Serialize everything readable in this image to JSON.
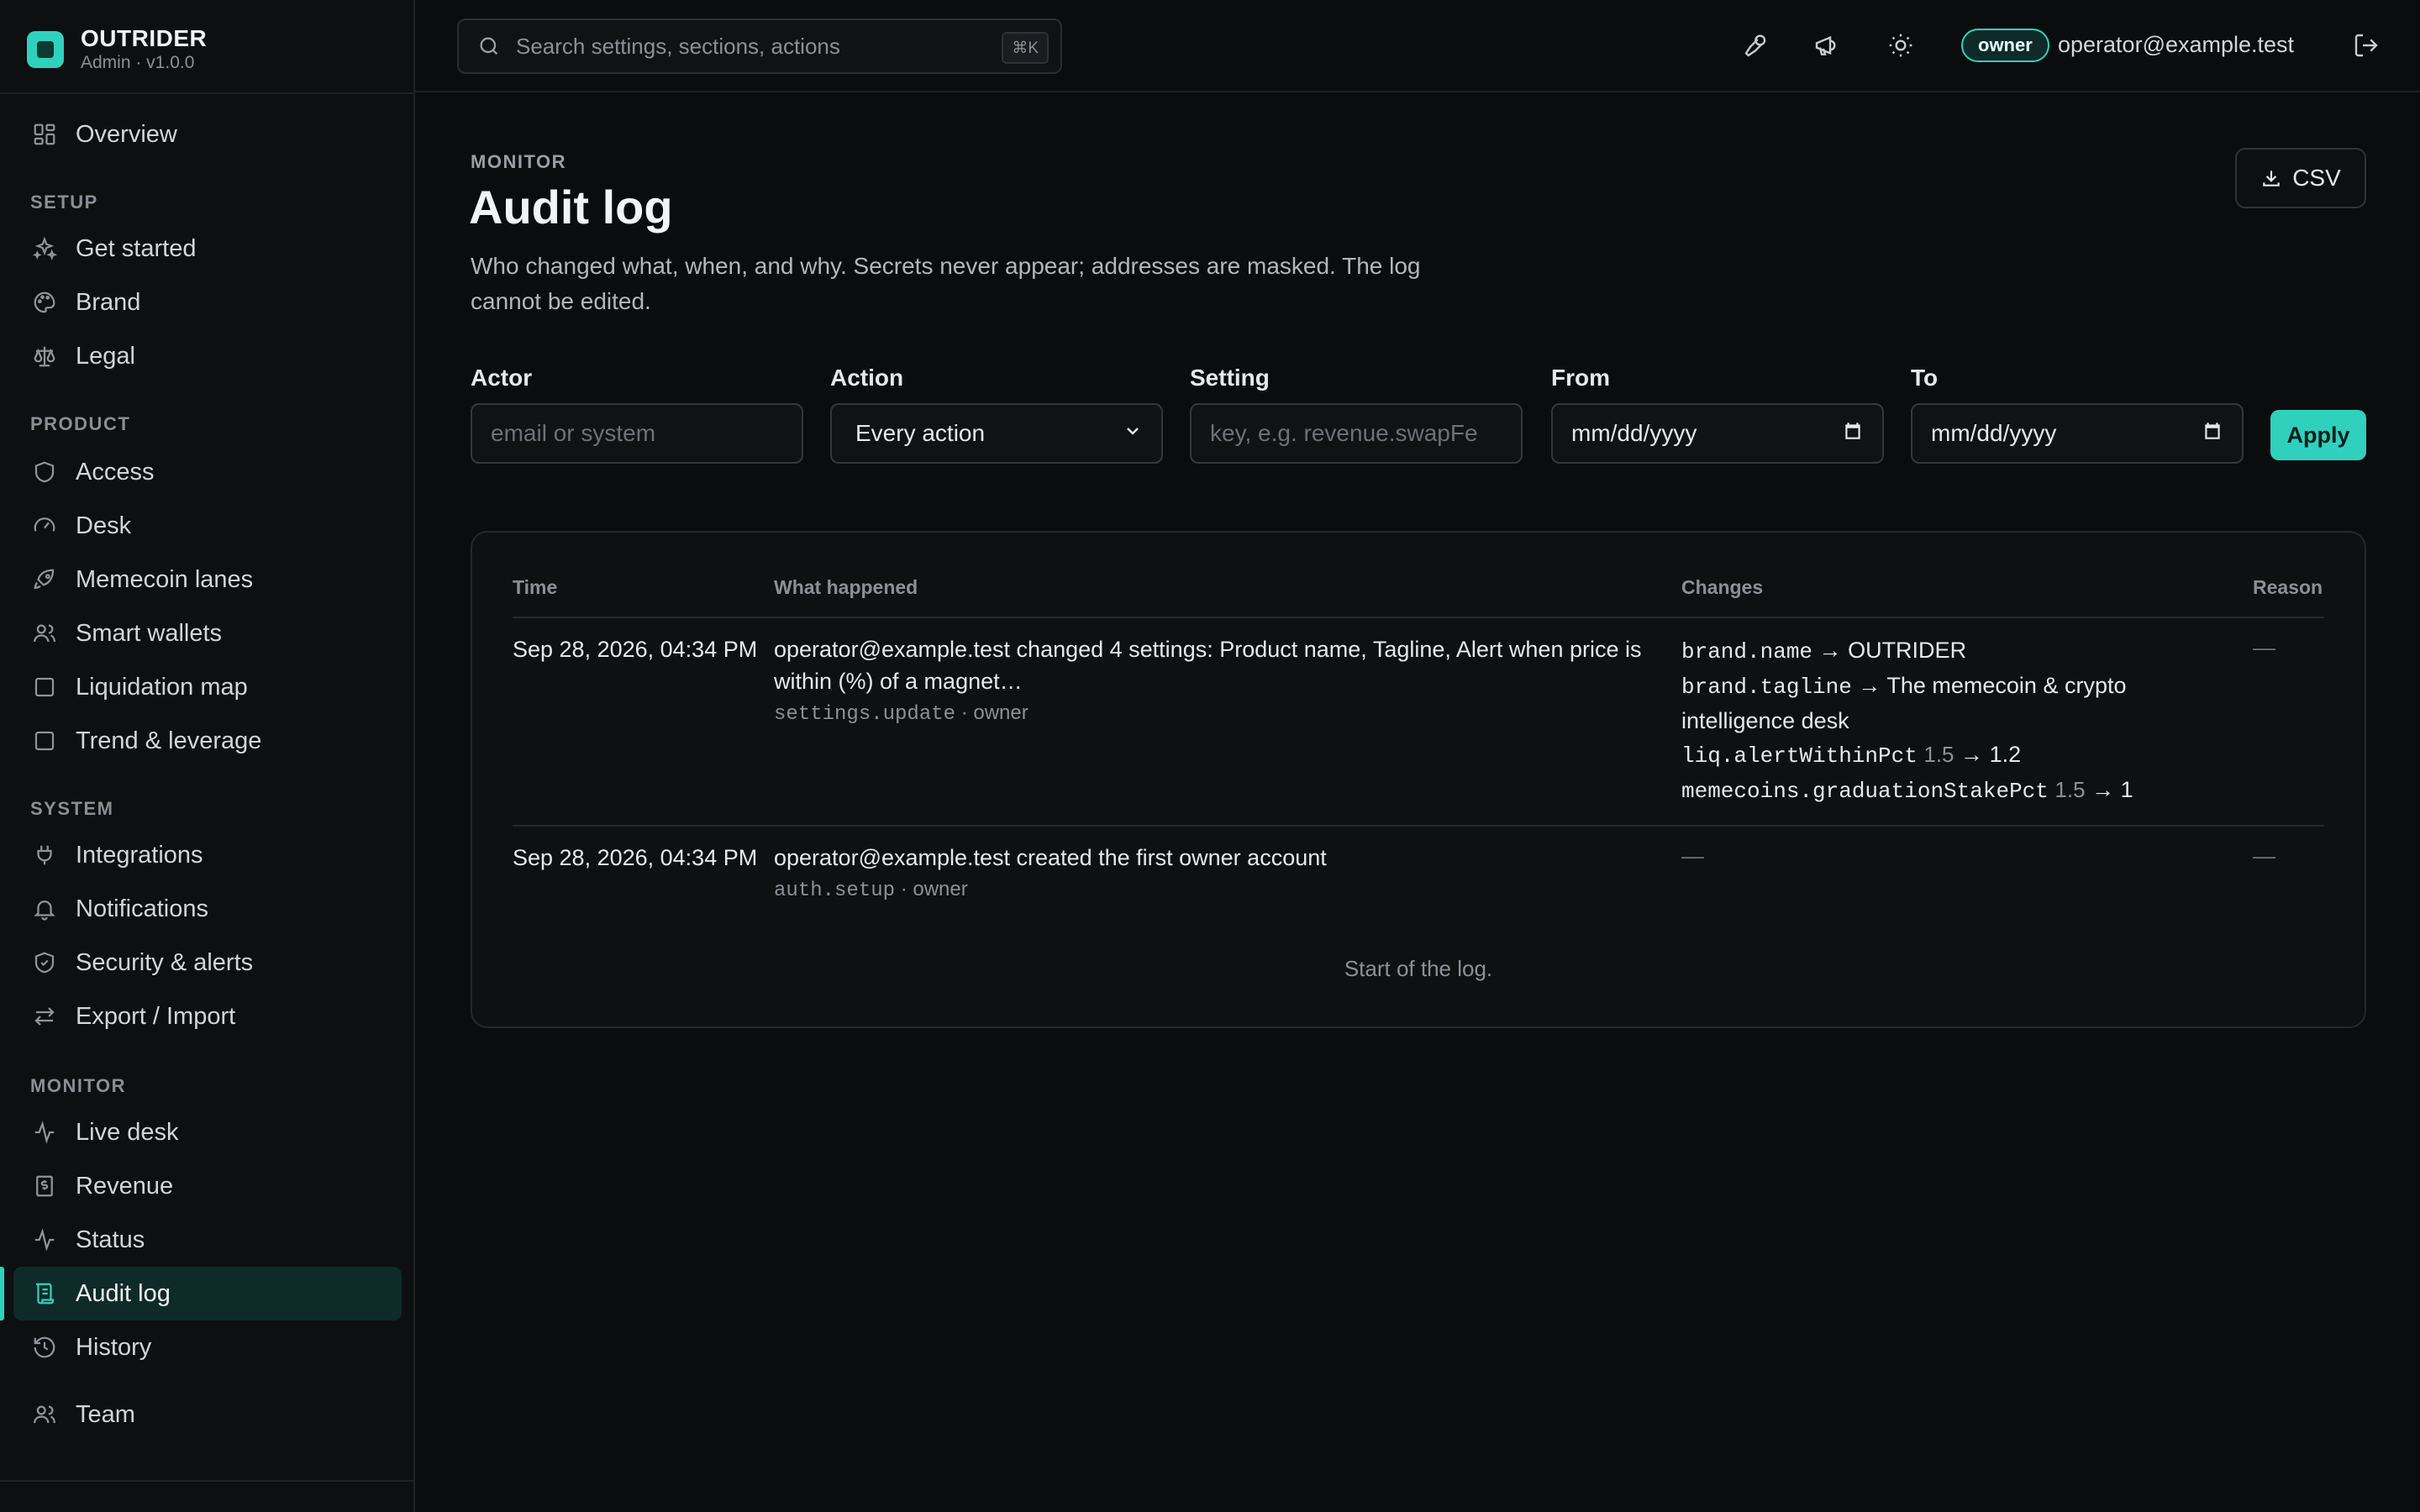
{
  "app": {
    "name": "OUTRIDER",
    "version": "Admin · v1.0.0"
  },
  "sidebar": {
    "overview": "Overview",
    "sections": [
      {
        "label": "SETUP",
        "items": [
          "Get started",
          "Brand",
          "Legal"
        ]
      },
      {
        "label": "PRODUCT",
        "items": [
          "Access",
          "Desk",
          "Memecoin lanes",
          "Smart wallets",
          "Liquidation map",
          "Trend & leverage"
        ]
      },
      {
        "label": "SYSTEM",
        "items": [
          "Integrations",
          "Notifications",
          "Security & alerts",
          "Export / Import"
        ]
      },
      {
        "label": "MONITOR",
        "items": [
          "Live desk",
          "Revenue",
          "Status",
          "Audit log",
          "History"
        ]
      }
    ],
    "team": "Team",
    "active_item": "Audit log"
  },
  "topbar": {
    "search_placeholder": "Search settings, sections, actions",
    "search_shortcut": "⌘K",
    "role": "owner",
    "user_email": "operator@example.test"
  },
  "page": {
    "eyebrow": "MONITOR",
    "title": "Audit log",
    "description": "Who changed what, when, and why. Secrets never appear; addresses are masked. The log cannot be edited.",
    "csv_label": "CSV"
  },
  "filters": {
    "actor": {
      "label": "Actor",
      "placeholder": "email or system"
    },
    "action": {
      "label": "Action",
      "value": "Every action"
    },
    "setting": {
      "label": "Setting",
      "placeholder": "key, e.g. revenue.swapFe"
    },
    "from": {
      "label": "From",
      "placeholder": "mm/dd/yyyy"
    },
    "to": {
      "label": "To",
      "placeholder": "mm/dd/yyyy"
    },
    "apply_label": "Apply"
  },
  "table": {
    "columns": [
      "Time",
      "What happened",
      "Changes",
      "Reason"
    ],
    "rows": [
      {
        "time": "Sep 28, 2026, 04:34 PM",
        "summary_line1": "operator@example.test changed 4 settings: Product name, Tagline, Alert when price is",
        "summary_line2": "within (%) of a magnet…",
        "event": "settings.update",
        "role": "· owner",
        "changes": {
          "c1_key": "brand.name",
          "c1_new": "OUTRIDER",
          "c2_key": "brand.tagline",
          "c2_new_line1": "The memecoin & crypto",
          "c2_new_line2": "intelligence desk",
          "c3_key": "liq.alertWithinPct",
          "c3_old": "1.5",
          "c3_new": "1.2",
          "c4_key": "memecoins.graduationStakePct",
          "c4_old": "1.5",
          "c4_new": "1"
        },
        "reason": "—"
      },
      {
        "time": "Sep 28, 2026, 04:34 PM",
        "summary_line1": "operator@example.test created the first owner account",
        "event": "auth.setup",
        "role": "· owner",
        "changes_text": "—",
        "reason": "—"
      }
    ],
    "footnote": "Start of the log.",
    "arrow": "→"
  }
}
